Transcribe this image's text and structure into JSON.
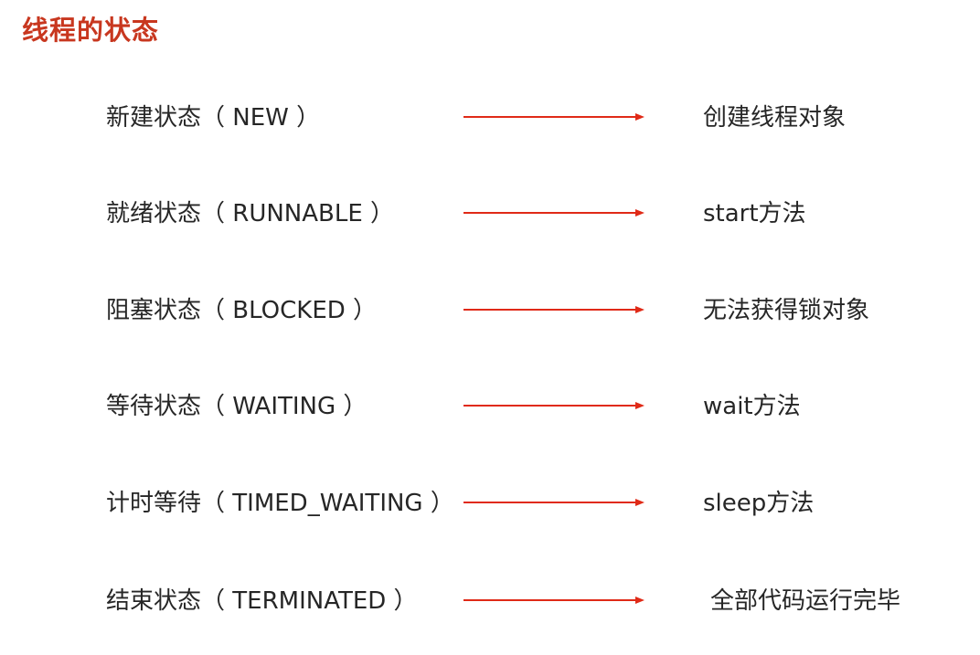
{
  "title": "线程的状态",
  "colors": {
    "title": "#c8371f",
    "arrow": "#e02a17",
    "text": "#262626"
  },
  "rows": [
    {
      "state": "新建状态（ NEW ）",
      "desc": "创建线程对象"
    },
    {
      "state": "就绪状态（ RUNNABLE ）",
      "desc": "start方法"
    },
    {
      "state": "阻塞状态（ BLOCKED ）",
      "desc": "无法获得锁对象"
    },
    {
      "state": "等待状态（ WAITING ）",
      "desc": "wait方法"
    },
    {
      "state": "计时等待（ TIMED_WAITING ）",
      "desc": "sleep方法"
    },
    {
      "state": "结束状态（ TERMINATED ）",
      "desc": "全部代码运行完毕"
    }
  ]
}
